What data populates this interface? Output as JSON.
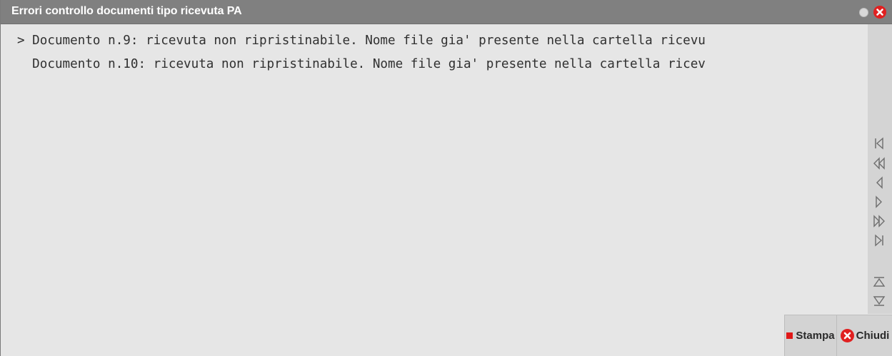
{
  "window": {
    "title": "Errori controllo documenti tipo ricevuta PA"
  },
  "messages": [
    "> Documento n.9: ricevuta non ripristinabile. Nome file gia' presente nella cartella ricevu",
    "  Documento n.10: ricevuta non ripristinabile. Nome file gia' presente nella cartella ricev"
  ],
  "navigation": {
    "buttons": [
      "first-icon",
      "page-up-icon",
      "previous-icon",
      "next-icon",
      "page-down-icon",
      "last-icon",
      "scroll-top-icon",
      "scroll-bottom-icon"
    ]
  },
  "buttons": {
    "stampa": "Stampa",
    "chiudi": "Chiudi"
  },
  "colors": {
    "titlebar": "#808080",
    "close": "#e02020",
    "background": "#e6e6e6"
  }
}
